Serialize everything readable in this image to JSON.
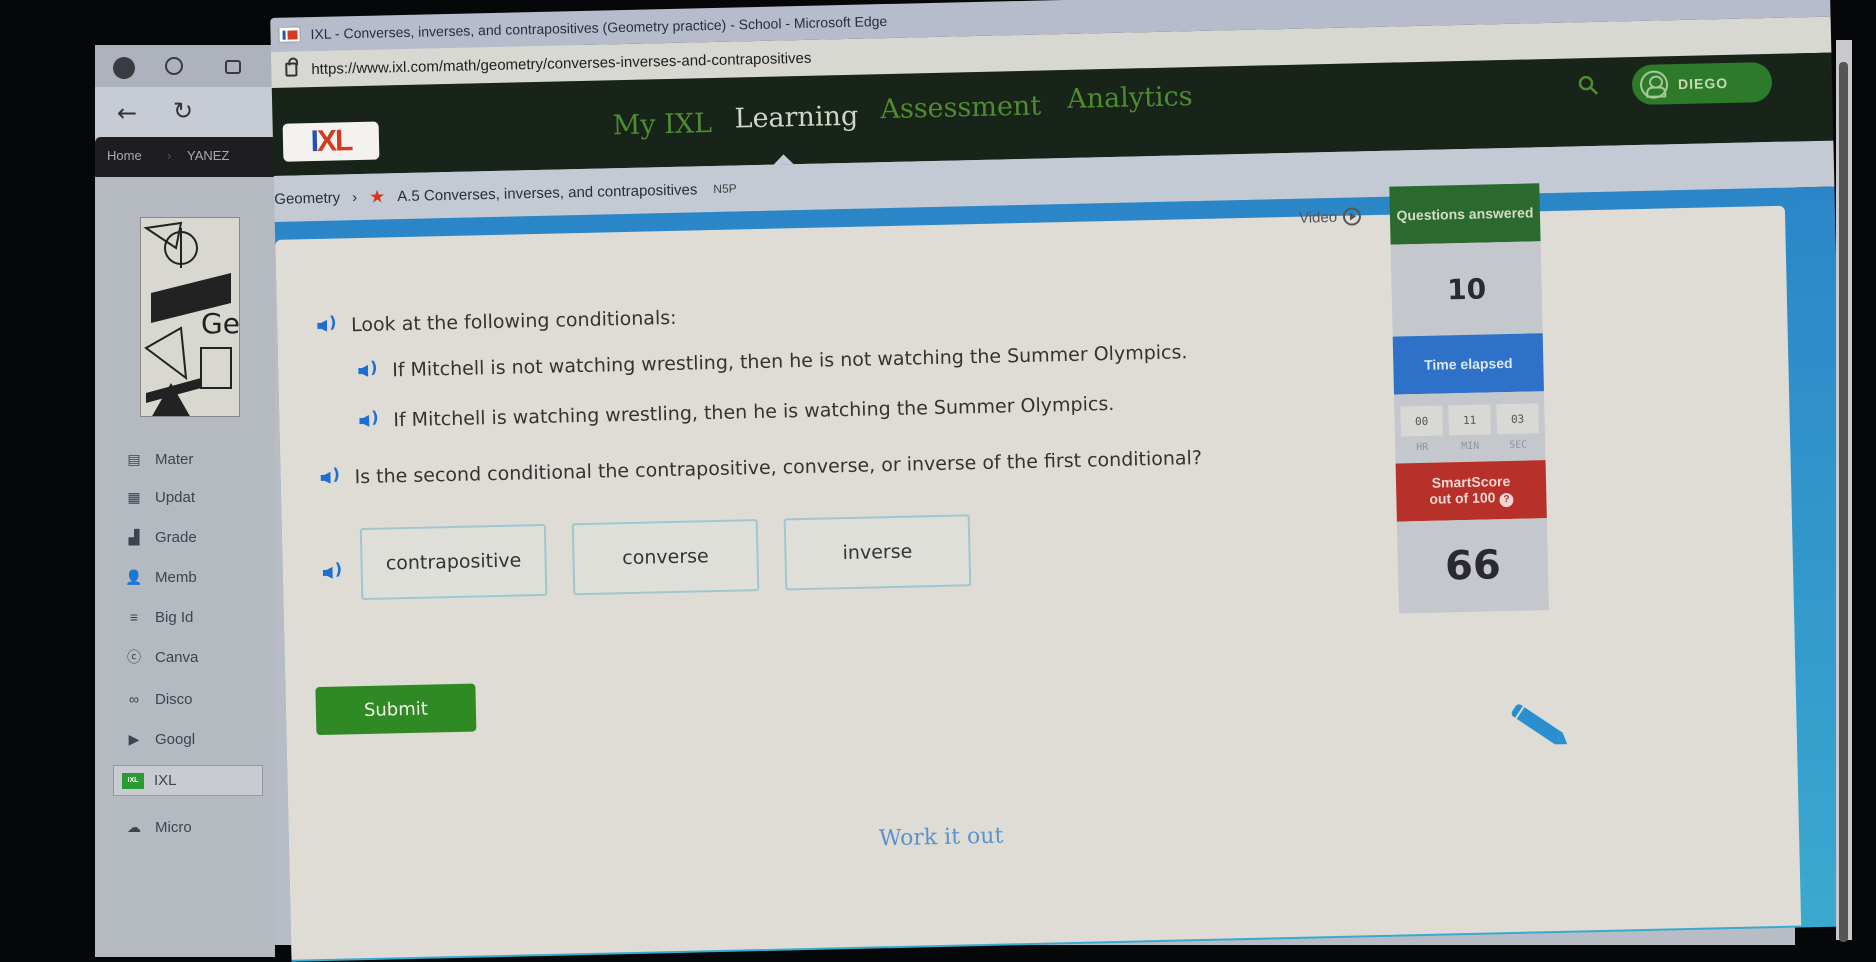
{
  "background_window": {
    "breadcrumb": [
      "Home",
      "YANEZ"
    ],
    "sidebar_items": [
      {
        "label": "Mater",
        "icon": "materials-icon"
      },
      {
        "label": "Updat",
        "icon": "updates-icon"
      },
      {
        "label": "Grade",
        "icon": "grades-icon"
      },
      {
        "label": "Memb",
        "icon": "members-icon"
      },
      {
        "label": "Big Id",
        "icon": "big-ideas-icon"
      },
      {
        "label": "Canva",
        "icon": "canvas-icon"
      },
      {
        "label": "Disco",
        "icon": "discord-icon"
      },
      {
        "label": "Googl",
        "icon": "google-meet-icon"
      },
      {
        "label": "IXL",
        "icon": "ixl-icon"
      },
      {
        "label": "Micro",
        "icon": "microsoft-icon"
      }
    ],
    "geo_art_text": "Ge"
  },
  "browser": {
    "title": "IXL - Converses, inverses, and contrapositives (Geometry practice) - School - Microsoft Edge",
    "url": "https://www.ixl.com/math/geometry/converses-inverses-and-contrapositives"
  },
  "ixl": {
    "logo": {
      "i": "I",
      "xl": "XL"
    },
    "nav": [
      {
        "label": "My IXL",
        "active": false
      },
      {
        "label": "Learning",
        "active": true
      },
      {
        "label": "Assessment",
        "active": false
      },
      {
        "label": "Analytics",
        "active": false
      }
    ],
    "user": "DIEGO",
    "breadcrumb": {
      "subject": "Geometry",
      "separator": "›",
      "skill": "A.5 Converses, inverses, and contrapositives",
      "code": "N5P"
    }
  },
  "question": {
    "intro": "Look at the following conditionals:",
    "conditionals": [
      "If Mitchell is not watching wrestling, then he is not watching the Summer Olympics.",
      "If Mitchell is watching wrestling, then he is watching the Summer Olympics."
    ],
    "prompt": "Is the second conditional the contrapositive, converse, or inverse of the first conditional?",
    "choices": [
      "contrapositive",
      "converse",
      "inverse"
    ],
    "submit_label": "Submit",
    "work_it_out": "Work it out",
    "video_label": "Video"
  },
  "stats": {
    "questions_answered_label": "Questions answered",
    "questions_answered": "10",
    "time_elapsed_label": "Time elapsed",
    "time": {
      "hr": "00",
      "min": "11",
      "sec": "03"
    },
    "time_units": {
      "hr": "HR",
      "min": "MIN",
      "sec": "SEC"
    },
    "smartscore_label": "SmartScore",
    "smartscore_sub": "out of 100",
    "smartscore": "66",
    "help_symbol": "?"
  },
  "colors": {
    "ixl_header": "#18231a",
    "nav_green": "#4e8c2e",
    "submit_green": "#2f8a26",
    "smartscore_red": "#b8302a",
    "time_blue": "#2d72c8",
    "questions_green": "#2a6a2e"
  }
}
